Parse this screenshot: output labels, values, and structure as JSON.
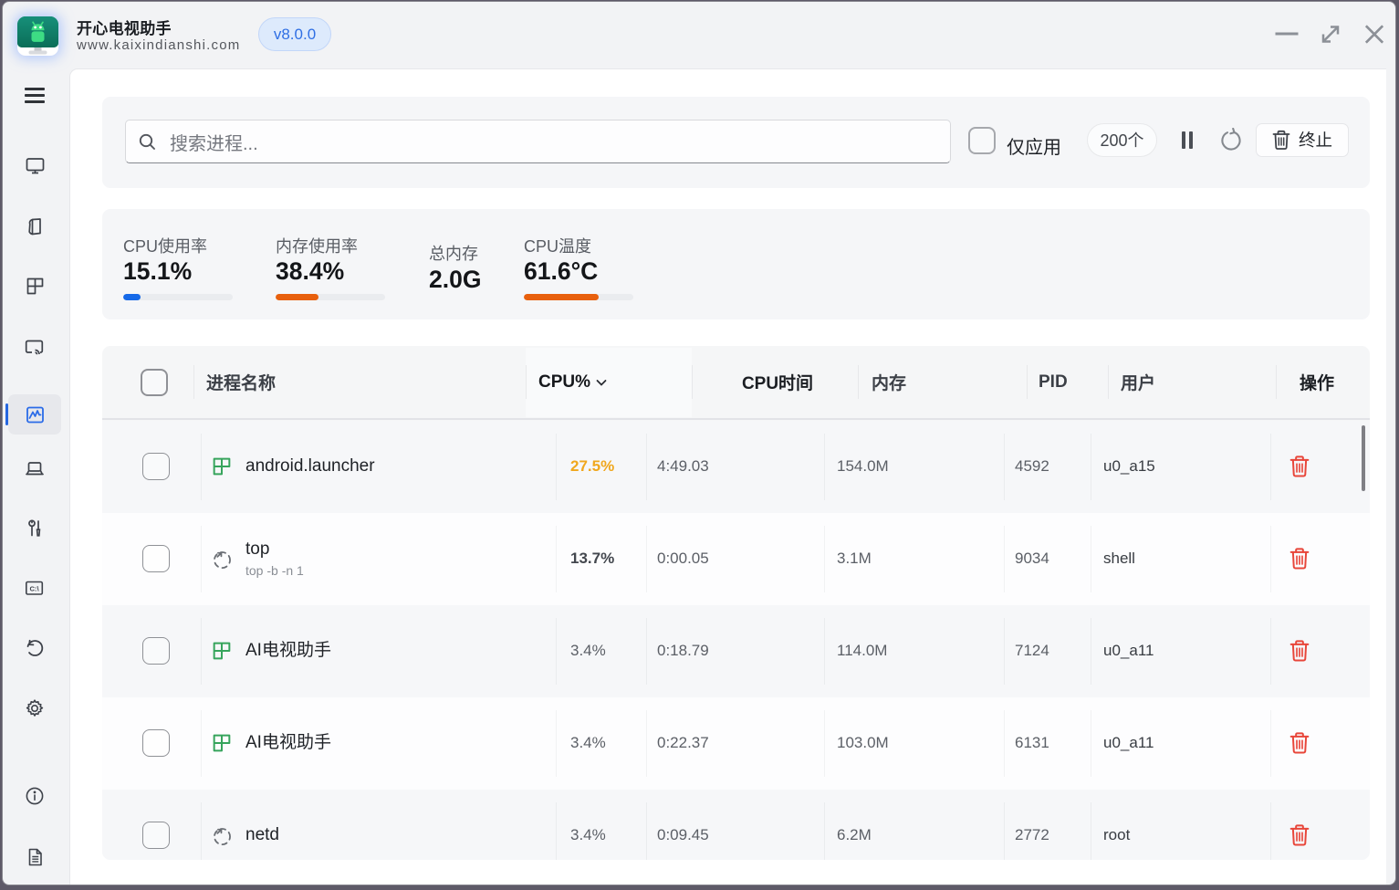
{
  "window": {
    "title": "开心电视助手",
    "subtitle": "www.kaixindianshi.com",
    "version_badge": "v8.0.0"
  },
  "toolbar": {
    "search_placeholder": "搜索进程...",
    "only_apps_label": "仅应用",
    "count_badge": "200个",
    "kill_button_label": "终止"
  },
  "stats": [
    {
      "label": "CPU使用率",
      "value": "15.1%",
      "bar_percent": 16,
      "bar_color": "#1569e8"
    },
    {
      "label": "内存使用率",
      "value": "38.4%",
      "bar_percent": 39.5,
      "bar_color": "#e8600d"
    },
    {
      "label": "总内存",
      "value": "2.0G",
      "bar_percent": null
    },
    {
      "label": "CPU温度",
      "value": "61.6°C",
      "bar_percent": 68,
      "bar_color": "#e8600d"
    }
  ],
  "table": {
    "columns": {
      "name": "进程名称",
      "cpu": "CPU%",
      "cpu_time": "CPU时间",
      "memory": "内存",
      "pid": "PID",
      "user": "用户",
      "actions": "操作"
    },
    "sorted_column": "CPU%",
    "rows": [
      {
        "name": "android.launcher",
        "cmd": "",
        "icon": "app",
        "cpu": "27.5%",
        "cpu_level": "high",
        "time": "4:49.03",
        "mem": "154.0M",
        "pid": "4592",
        "user": "u0_a15"
      },
      {
        "name": "top",
        "cmd": "top -b -n 1",
        "icon": "process",
        "cpu": "13.7%",
        "cpu_level": "mid",
        "time": "0:00.05",
        "mem": "3.1M",
        "pid": "9034",
        "user": "shell"
      },
      {
        "name": "AI电视助手",
        "cmd": "",
        "icon": "app",
        "cpu": "3.4%",
        "cpu_level": "low",
        "time": "0:18.79",
        "mem": "114.0M",
        "pid": "7124",
        "user": "u0_a11"
      },
      {
        "name": "AI电视助手",
        "cmd": "",
        "icon": "app",
        "cpu": "3.4%",
        "cpu_level": "low",
        "time": "0:22.37",
        "mem": "103.0M",
        "pid": "6131",
        "user": "u0_a11"
      },
      {
        "name": "netd",
        "cmd": "",
        "icon": "process",
        "cpu": "3.4%",
        "cpu_level": "low",
        "time": "0:09.45",
        "mem": "6.2M",
        "pid": "2772",
        "user": "root"
      }
    ]
  },
  "colors": {
    "accent_blue": "#1569e8",
    "accent_orange": "#e8600d",
    "cpu_high_amber": "#f0a71d",
    "danger_red": "#e8463a",
    "app_green": "#36a45c",
    "chrome_bg": "#f2f3f5",
    "card_bg": "#f5f6f8"
  }
}
